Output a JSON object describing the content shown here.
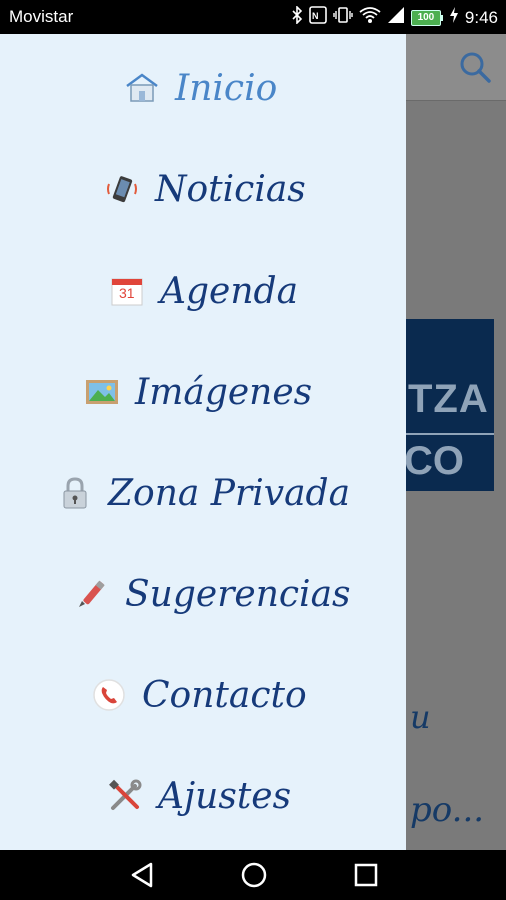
{
  "status_bar": {
    "carrier": "Movistar",
    "battery": "100",
    "time": "9:46",
    "icons": [
      "bluetooth-icon",
      "nfc-icon",
      "vibrate-icon",
      "wifi-icon",
      "signal-icon",
      "battery-icon",
      "charging-icon"
    ]
  },
  "drawer": {
    "items": [
      {
        "label": "Inicio",
        "icon": "home-icon",
        "active": true
      },
      {
        "label": "Noticias",
        "icon": "phone-ringing-icon"
      },
      {
        "label": "Agenda",
        "icon": "calendar-icon",
        "calendar_day": "31"
      },
      {
        "label": "Imágenes",
        "icon": "picture-icon"
      },
      {
        "label": "Zona Privada",
        "icon": "lock-icon"
      },
      {
        "label": "Sugerencias",
        "icon": "pen-icon"
      },
      {
        "label": "Contacto",
        "icon": "telephone-icon"
      },
      {
        "label": "Ajustes",
        "icon": "tools-icon"
      }
    ]
  },
  "background": {
    "banner_line1": "TZA",
    "banner_line2": "CO",
    "text_line1": "u",
    "text_line2": "po..."
  },
  "colors": {
    "drawer_bg": "#e6f2fb",
    "item_text": "#163a7a",
    "active_text": "#4a86c8",
    "battery": "#4caf50"
  }
}
